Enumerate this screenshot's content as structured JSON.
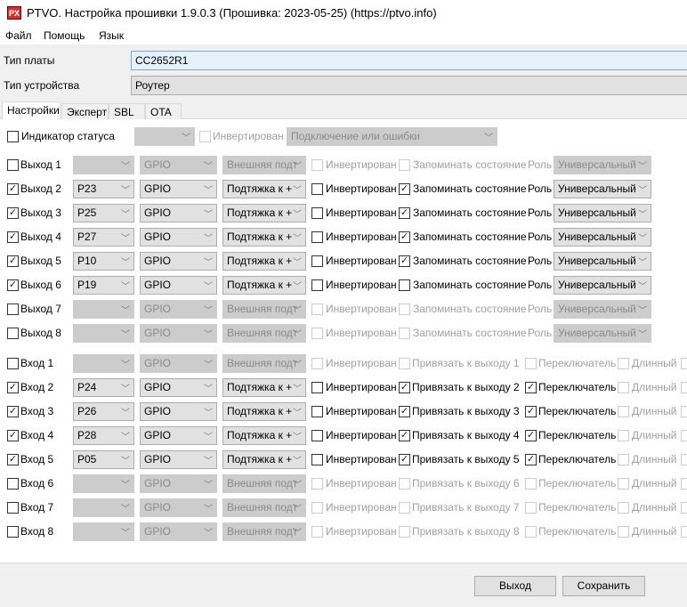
{
  "window": {
    "title": "PTVO. Настройка прошивки 1.9.0.3 (Прошивка: 2023-05-25) (https://ptvo.info)",
    "icon_text": "PX"
  },
  "menu": [
    "Файл",
    "Помощь",
    "Язык"
  ],
  "board": {
    "label": "Тип платы",
    "value": "CC2652R1"
  },
  "device": {
    "label": "Тип устройства",
    "value": "Роутер"
  },
  "tabs": [
    "Настройки",
    "Эксперт",
    "SBL",
    "OTA"
  ],
  "status": {
    "label": "Индикатор статуса",
    "checked": false,
    "pin": "",
    "invert_label": "Инвертирован",
    "mode": "Подключение или ошибки"
  },
  "labels": {
    "inverted": "Инвертирован",
    "remember": "Запоминать состояние",
    "role": "Роль",
    "bind_prefix": "Привязать к выходу",
    "switch": "Переключатель",
    "long": "Длинный"
  },
  "outputs": [
    {
      "label": "Выход 1",
      "checked": false,
      "pin": "",
      "type": "GPIO",
      "pull": "Внешняя подт",
      "inverted": false,
      "remember": false,
      "role": "Универсальный",
      "enabled": false
    },
    {
      "label": "Выход 2",
      "checked": true,
      "pin": "P23",
      "type": "GPIO",
      "pull": "Подтяжка к +",
      "inverted": false,
      "remember": true,
      "role": "Универсальный",
      "enabled": true
    },
    {
      "label": "Выход 3",
      "checked": true,
      "pin": "P25",
      "type": "GPIO",
      "pull": "Подтяжка к +",
      "inverted": false,
      "remember": true,
      "role": "Универсальный",
      "enabled": true
    },
    {
      "label": "Выход 4",
      "checked": true,
      "pin": "P27",
      "type": "GPIO",
      "pull": "Подтяжка к +",
      "inverted": false,
      "remember": true,
      "role": "Универсальный",
      "enabled": true
    },
    {
      "label": "Выход 5",
      "checked": true,
      "pin": "P10",
      "type": "GPIO",
      "pull": "Подтяжка к +",
      "inverted": false,
      "remember": true,
      "role": "Универсальный",
      "enabled": true
    },
    {
      "label": "Выход 6",
      "checked": true,
      "pin": "P19",
      "type": "GPIO",
      "pull": "Подтяжка к +",
      "inverted": false,
      "remember": false,
      "role": "Универсальный",
      "enabled": true
    },
    {
      "label": "Выход 7",
      "checked": false,
      "pin": "",
      "type": "GPIO",
      "pull": "Внешняя подт",
      "inverted": false,
      "remember": false,
      "role": "Универсальный",
      "enabled": false
    },
    {
      "label": "Выход 8",
      "checked": false,
      "pin": "",
      "type": "GPIO",
      "pull": "Внешняя подт",
      "inverted": false,
      "remember": false,
      "role": "Универсальный",
      "enabled": false
    }
  ],
  "inputs": [
    {
      "label": "Вход 1",
      "checked": false,
      "pin": "",
      "type": "GPIO",
      "pull": "Внешняя подт",
      "inverted": false,
      "bind": "Привязать к выходу 1",
      "bound": false,
      "switch": false,
      "long": false,
      "enabled": false
    },
    {
      "label": "Вход 2",
      "checked": true,
      "pin": "P24",
      "type": "GPIO",
      "pull": "Подтяжка к +",
      "inverted": false,
      "bind": "Привязать к выходу 2",
      "bound": true,
      "switch": true,
      "long": false,
      "enabled": true
    },
    {
      "label": "Вход 3",
      "checked": true,
      "pin": "P26",
      "type": "GPIO",
      "pull": "Подтяжка к +",
      "inverted": false,
      "bind": "Привязать к выходу 3",
      "bound": true,
      "switch": true,
      "long": false,
      "enabled": true
    },
    {
      "label": "Вход 4",
      "checked": true,
      "pin": "P28",
      "type": "GPIO",
      "pull": "Подтяжка к +",
      "inverted": false,
      "bind": "Привязать к выходу 4",
      "bound": true,
      "switch": true,
      "long": false,
      "enabled": true
    },
    {
      "label": "Вход 5",
      "checked": true,
      "pin": "P05",
      "type": "GPIO",
      "pull": "Подтяжка к +",
      "inverted": false,
      "bind": "Привязать к выходу 5",
      "bound": true,
      "switch": true,
      "long": false,
      "enabled": true
    },
    {
      "label": "Вход 6",
      "checked": false,
      "pin": "",
      "type": "GPIO",
      "pull": "Внешняя подт",
      "inverted": false,
      "bind": "Привязать к выходу 6",
      "bound": false,
      "switch": false,
      "long": false,
      "enabled": false
    },
    {
      "label": "Вход 7",
      "checked": false,
      "pin": "",
      "type": "GPIO",
      "pull": "Внешняя подт",
      "inverted": false,
      "bind": "Привязать к выходу 7",
      "bound": false,
      "switch": false,
      "long": false,
      "enabled": false
    },
    {
      "label": "Вход 8",
      "checked": false,
      "pin": "",
      "type": "GPIO",
      "pull": "Внешняя подт",
      "inverted": false,
      "bind": "Привязать к выходу 8",
      "bound": false,
      "switch": false,
      "long": false,
      "enabled": false
    }
  ],
  "buttons": {
    "exit": "Выход",
    "save": "Сохранить"
  }
}
